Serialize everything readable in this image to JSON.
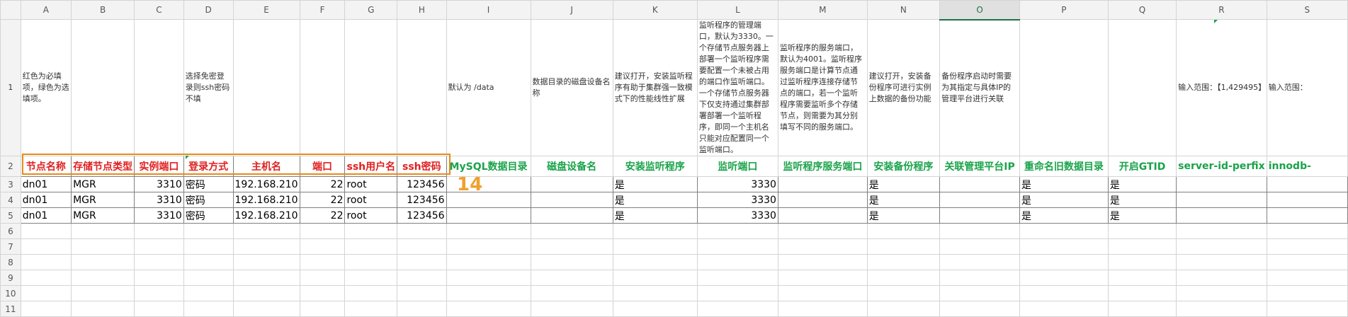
{
  "columns": [
    "A",
    "B",
    "C",
    "D",
    "E",
    "F",
    "G",
    "H",
    "I",
    "J",
    "K",
    "L",
    "M",
    "N",
    "O",
    "P",
    "Q",
    "R",
    "S"
  ],
  "rows": [
    "1",
    "2",
    "3",
    "4",
    "5",
    "6",
    "7",
    "8",
    "9",
    "10",
    "11"
  ],
  "notes": {
    "A": "红色为必填项，绿色为选填项。",
    "D": "选择免密登录则ssh密码不填",
    "I": "默认为 /data",
    "J": "数据目录的磁盘设备名称",
    "K": "建议打开，安装监听程序有助于集群强一致模式下的性能线性扩展",
    "L": "监听程序的管理端口，默认为3330。一个存储节点服务器上部署一个监听程序需要配置一个未被占用的端口作监听端口。一个存储节点服务器下仅支持通过集群部署部署一个监听程序，即同一个主机名只能对应配置同一个监听端口。",
    "M": "监听程序的服务端口，默认为4001。监听程序服务端口是计算节点通过监听程序连接存储节点的端口，若一个监听程序需要监听多个存储节点，则需要为其分别填写不同的服务端口。",
    "N": "建议打开，安装备份程序可进行实例上数据的备份功能",
    "O": "备份程序启动时需要为其指定与具体IP的管理平台进行关联",
    "R": "输入范围：【1,429495】",
    "S": "输入范围："
  },
  "headers": [
    "节点名称",
    "存储节点类型",
    "实例端口",
    "登录方式",
    "主机名",
    "端口",
    "ssh用户名",
    "ssh密码",
    "MySQL数据目录",
    "磁盘设备名",
    "安装监听程序",
    "监听端口",
    "监听程序服务端口",
    "安装备份程序",
    "关联管理平台IP",
    "重命名旧数据目录",
    "开启GTID",
    "server-id-perfix",
    "innodb-"
  ],
  "data_rows": [
    [
      "dn01",
      "MGR",
      "3310",
      "密码",
      "192.168.210",
      "22",
      "root",
      "123456",
      "",
      "",
      "是",
      "3330",
      "",
      "是",
      "",
      "是",
      "是",
      "",
      ""
    ],
    [
      "dn01",
      "MGR",
      "3310",
      "密码",
      "192.168.210",
      "22",
      "root",
      "123456",
      "",
      "",
      "是",
      "3330",
      "",
      "是",
      "",
      "是",
      "是",
      "",
      ""
    ],
    [
      "dn01",
      "MGR",
      "3310",
      "密码",
      "192.168.210",
      "22",
      "root",
      "123456",
      "",
      "",
      "是",
      "3330",
      "",
      "是",
      "",
      "是",
      "是",
      "",
      ""
    ]
  ],
  "badge": "14",
  "colors": {
    "required": "#e02020",
    "optional": "#1aa34a",
    "highlight": "#e88a1a",
    "badge": "#f0a030"
  }
}
